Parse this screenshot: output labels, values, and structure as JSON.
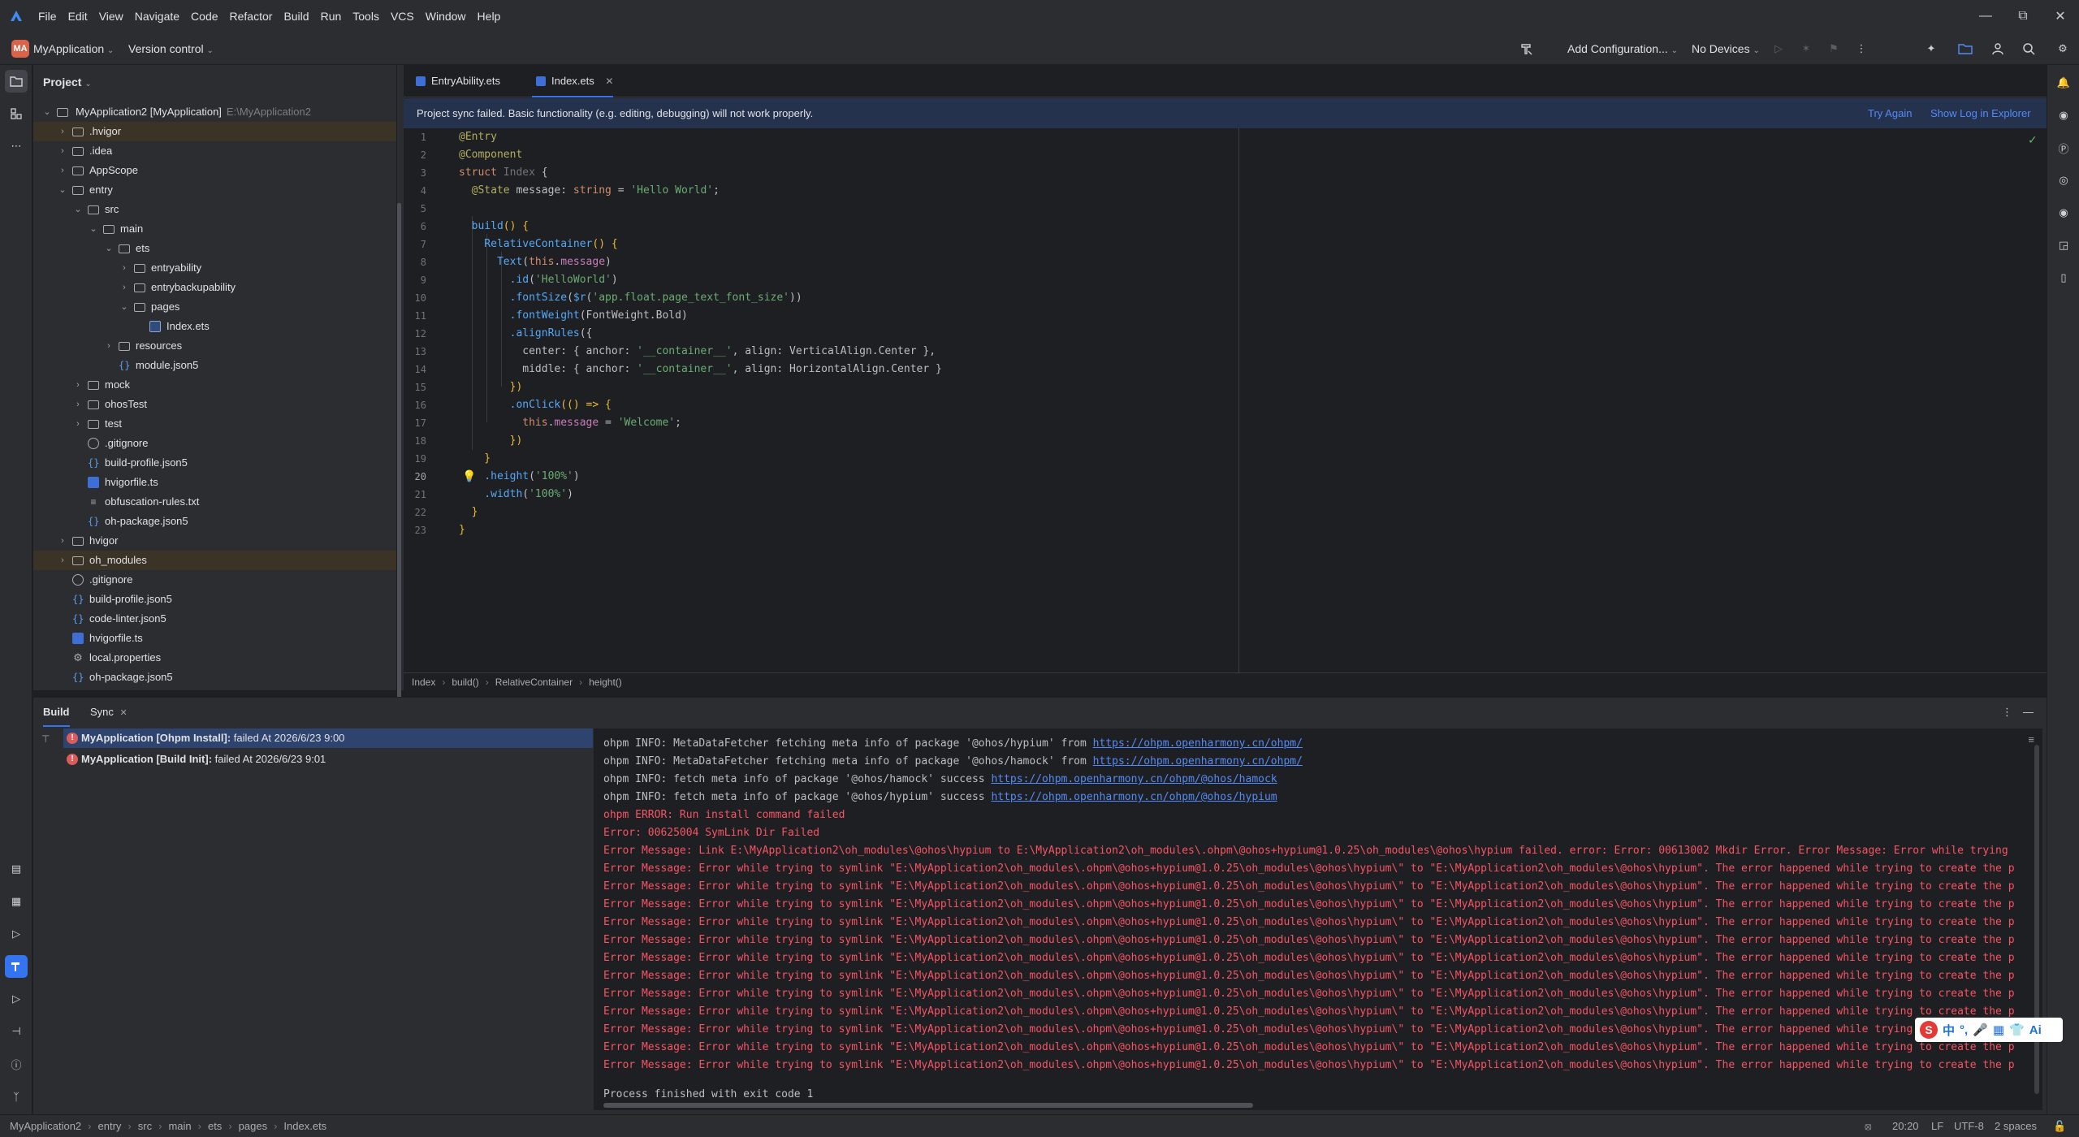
{
  "menu": [
    "File",
    "Edit",
    "View",
    "Navigate",
    "Code",
    "Refactor",
    "Build",
    "Run",
    "Tools",
    "VCS",
    "Window",
    "Help"
  ],
  "toolbar": {
    "project_badge": "MA",
    "project_name": "MyApplication",
    "vcs": "Version control",
    "run_config": "Add Configuration...",
    "device": "No Devices"
  },
  "project_panel": {
    "title": "Project",
    "root_name": "MyApplication2 [MyApplication]",
    "root_path": "E:\\MyApplication2",
    "items": [
      {
        "label": ".hvigor"
      },
      {
        "label": ".idea"
      },
      {
        "label": "AppScope"
      },
      {
        "label": "entry"
      },
      {
        "label": "src"
      },
      {
        "label": "main"
      },
      {
        "label": "ets"
      },
      {
        "label": "entryability"
      },
      {
        "label": "entrybackupability"
      },
      {
        "label": "pages"
      },
      {
        "label": "Index.ets"
      },
      {
        "label": "resources"
      },
      {
        "label": "module.json5"
      },
      {
        "label": "mock"
      },
      {
        "label": "ohosTest"
      },
      {
        "label": "test"
      },
      {
        "label": ".gitignore"
      },
      {
        "label": "build-profile.json5"
      },
      {
        "label": "hvigorfile.ts"
      },
      {
        "label": "obfuscation-rules.txt"
      },
      {
        "label": "oh-package.json5"
      },
      {
        "label": "hvigor"
      },
      {
        "label": "oh_modules"
      },
      {
        "label": ".gitignore"
      },
      {
        "label": "build-profile.json5"
      },
      {
        "label": "code-linter.json5"
      },
      {
        "label": "hvigorfile.ts"
      },
      {
        "label": "local.properties"
      },
      {
        "label": "oh-package.json5"
      }
    ]
  },
  "editor": {
    "tabs": [
      "EntryAbility.ets",
      "Index.ets"
    ],
    "banner": "Project sync failed. Basic functionality (e.g. editing, debugging) will not work properly.",
    "banner_try_again": "Try Again",
    "banner_show_log": "Show Log in Explorer",
    "line_numbers": [
      "1",
      "2",
      "3",
      "4",
      "5",
      "6",
      "7",
      "8",
      "9",
      "10",
      "11",
      "12",
      "13",
      "14",
      "15",
      "16",
      "17",
      "18",
      "19",
      "20",
      "21",
      "22",
      "23"
    ],
    "lines": {
      "l1": "@Entry",
      "l2": "@Component",
      "l3a": "struct ",
      "l3b": "Index",
      "l3c": " {",
      "l4a": "  @State",
      "l4b": " message: ",
      "l4c": "string",
      "l4d": " = ",
      "l4e": "'Hello World'",
      "l4f": ";",
      "l6a": "  build",
      "l6b": "() {",
      "l7a": "    RelativeContainer",
      "l7b": "() {",
      "l8a": "      Text",
      "l8b": "(",
      "l8c": "this",
      "l8d": ".",
      "l8e": "message",
      "l8f": ")",
      "l9a": "        .id",
      "l9b": "(",
      "l9c": "'HelloWorld'",
      "l9d": ")",
      "l10a": "        .fontSize",
      "l10b": "(",
      "l10c": "$r",
      "l10d": "(",
      "l10e": "'app.float.page_text_font_size'",
      "l10f": "))",
      "l11a": "        .fontWeight",
      "l11b": "(FontWeight.",
      "l11c": "Bold",
      "l11d": ")",
      "l12a": "        .alignRules",
      "l12b": "({",
      "l13a": "          center: { anchor: ",
      "l13b": "'__container__'",
      "l13c": ", align: VerticalAlign.",
      "l13d": "Center",
      "l13e": " },",
      "l14a": "          middle: { anchor: ",
      "l14b": "'__container__'",
      "l14c": ", align: HorizontalAlign.",
      "l14d": "Center",
      "l14e": " }",
      "l15": "        })",
      "l16a": "        .onClick",
      "l16b": "(() => {",
      "l17a": "          this",
      "l17b": ".",
      "l17c": "message",
      "l17d": " = ",
      "l17e": "'Welcome'",
      "l17f": ";",
      "l18": "        })",
      "l19": "    }",
      "l20a": "    .height",
      "l20b": "(",
      "l20c": "'100%'",
      "l20d": ")",
      "l21a": "    .width",
      "l21b": "(",
      "l21c": "'100%'",
      "l21d": ")",
      "l22": "  }",
      "l23": "}"
    },
    "breadcrumb": [
      "Index",
      "build()",
      "RelativeContainer",
      "height()"
    ]
  },
  "build_panel": {
    "tabs": [
      "Build",
      "Sync"
    ],
    "entries": [
      {
        "title": "MyApplication [Ohpm Install]:",
        "status": " failed At 2026/6/23 9:00"
      },
      {
        "title": "MyApplication [Build Init]:",
        "status": " failed At 2026/6/23 9:01"
      }
    ],
    "console": {
      "c1a": "ohpm INFO: MetaDataFetcher fetching meta info of package '@ohos/hypium' from ",
      "c1b": "https://ohpm.openharmony.cn/ohpm/",
      "c2a": "ohpm INFO: MetaDataFetcher fetching meta info of package '@ohos/hamock' from ",
      "c2b": "https://ohpm.openharmony.cn/ohpm/",
      "c3a": "ohpm INFO: fetch meta info of package '@ohos/hamock' success ",
      "c3b": "https://ohpm.openharmony.cn/ohpm/@ohos/hamock",
      "c4a": "ohpm INFO: fetch meta info of package '@ohos/hypium' success ",
      "c4b": "https://ohpm.openharmony.cn/ohpm/@ohos/hypium",
      "c5": "ohpm ERROR: Run install command failed",
      "c6": "Error: 00625004 SymLink Dir Failed",
      "c7": "Error Message: Link E:\\MyApplication2\\oh_modules\\@ohos\\hypium to E:\\MyApplication2\\oh_modules\\.ohpm\\@ohos+hypium@1.0.25\\oh_modules\\@ohos\\hypium failed. error: Error: 00613002 Mkdir Error. Error Message: Error while trying",
      "err_repeat": "Error Message: Error while trying to symlink \"E:\\MyApplication2\\oh_modules\\.ohpm\\@ohos+hypium@1.0.25\\oh_modules\\@ohos\\hypium\\\" to \"E:\\MyApplication2\\oh_modules\\@ohos\\hypium\". The error happened while trying to create the p",
      "finish": "Process finished with exit code 1"
    }
  },
  "statusbar": {
    "path": [
      "MyApplication2",
      "entry",
      "src",
      "main",
      "ets",
      "pages",
      "Index.ets"
    ],
    "position": "20:20",
    "line_sep": "LF",
    "encoding": "UTF-8",
    "indent": "2 spaces"
  },
  "ime": {
    "chars": [
      "中",
      "°,",
      "🎤",
      "▦",
      "👕",
      "Ai"
    ]
  }
}
